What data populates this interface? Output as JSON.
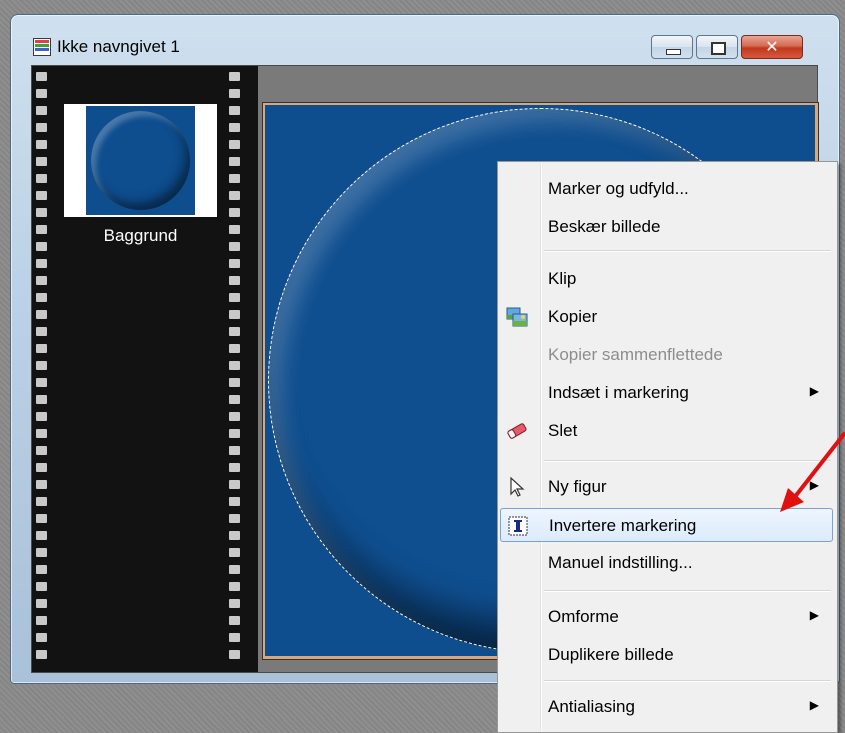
{
  "window": {
    "title": "Ikke navngivet 1",
    "close_glyph": "✕"
  },
  "layers": {
    "items": [
      {
        "label": "Baggrund"
      }
    ]
  },
  "context_menu": {
    "items": [
      {
        "label": "Marker og udfyld...",
        "icon": "",
        "enabled": true
      },
      {
        "label": "Beskær billede",
        "icon": "",
        "enabled": true
      },
      {
        "label": "Klip",
        "icon": "",
        "enabled": true
      },
      {
        "label": "Kopier",
        "icon": "copy-image-icon",
        "enabled": true
      },
      {
        "label": "Kopier sammenflettede",
        "icon": "",
        "enabled": false
      },
      {
        "label": "Indsæt i markering",
        "icon": "",
        "enabled": true,
        "submenu": true
      },
      {
        "label": "Slet",
        "icon": "eraser-icon",
        "enabled": true
      },
      {
        "label": "Ny figur",
        "icon": "pointer-icon",
        "enabled": true,
        "submenu": true
      },
      {
        "label": "Invertere markering",
        "icon": "invert-selection-icon",
        "enabled": true,
        "highlighted": true
      },
      {
        "label": "Manuel indstilling...",
        "icon": "",
        "enabled": true
      },
      {
        "label": "Omforme",
        "icon": "",
        "enabled": true,
        "submenu": true
      },
      {
        "label": "Duplikere billede",
        "icon": "",
        "enabled": true
      },
      {
        "label": "Antialiasing",
        "icon": "",
        "enabled": true,
        "submenu": true
      }
    ]
  },
  "colors": {
    "canvas_blue": "#0e4d8e",
    "highlight_border": "#7da2ce",
    "annotation_red": "#e01010"
  }
}
